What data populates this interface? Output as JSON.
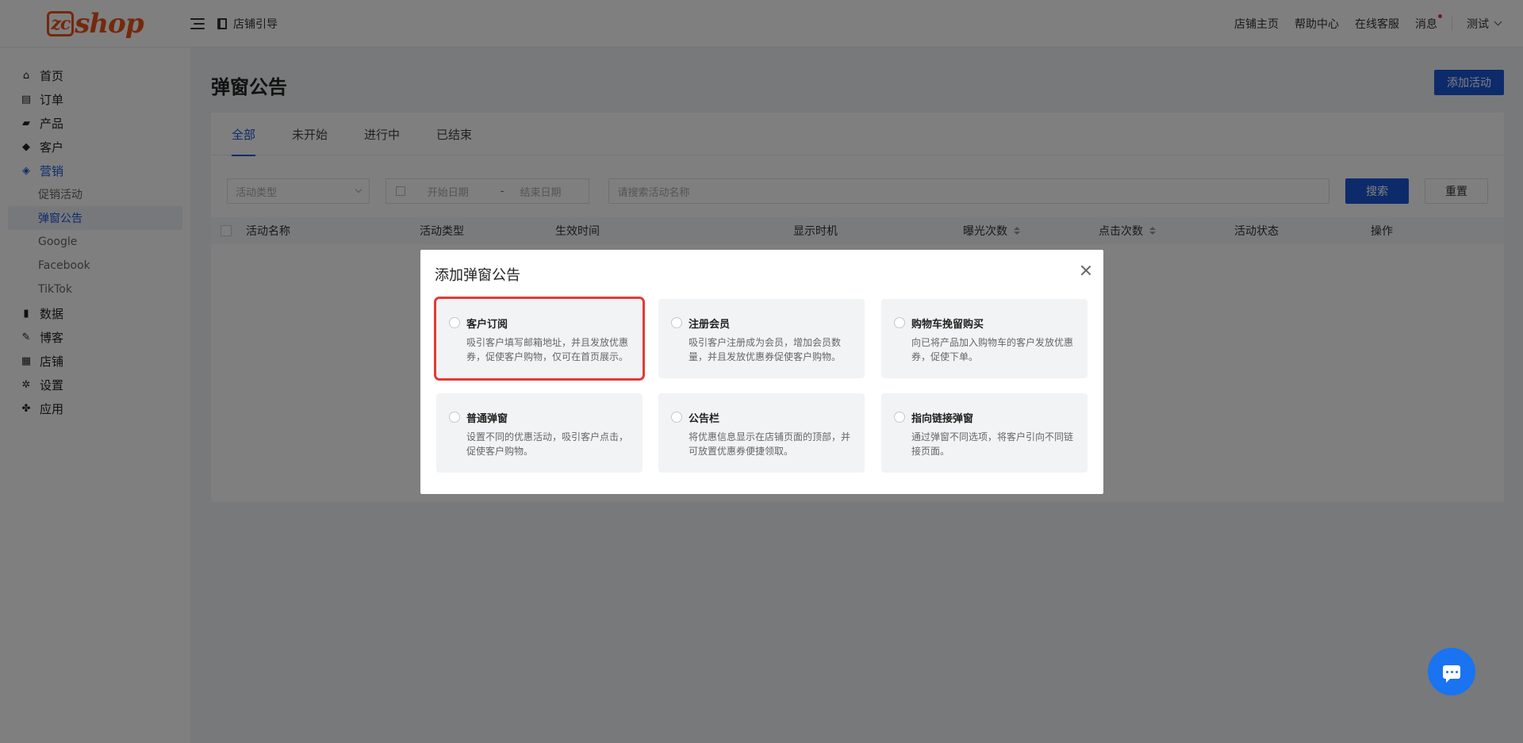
{
  "brand": {
    "logo_prefix": "zc",
    "logo_text": "shop",
    "logo_color": "#e8521a"
  },
  "header": {
    "store_guide": "店铺引导",
    "links": [
      "店铺主页",
      "帮助中心",
      "在线客服",
      "消息"
    ],
    "user": "测试"
  },
  "sidebar": {
    "items": [
      {
        "label": "首页",
        "icon": "home-icon"
      },
      {
        "label": "订单",
        "icon": "clipboard-icon"
      },
      {
        "label": "产品",
        "icon": "bag-icon"
      },
      {
        "label": "客户",
        "icon": "diamond-icon"
      },
      {
        "label": "营销",
        "icon": "tag-icon",
        "active": true
      },
      {
        "label": "数据",
        "icon": "bar-chart-icon"
      },
      {
        "label": "博客",
        "icon": "edit-icon"
      },
      {
        "label": "店铺",
        "icon": "store-icon"
      },
      {
        "label": "设置",
        "icon": "gear-icon"
      },
      {
        "label": "应用",
        "icon": "puzzle-icon"
      }
    ],
    "sub_items": [
      "促销活动",
      "弹窗公告",
      "Google",
      "Facebook",
      "TikTok"
    ],
    "selected_sub": "弹窗公告"
  },
  "page": {
    "title": "弹窗公告",
    "add_button": "添加活动",
    "tabs": [
      "全部",
      "未开始",
      "进行中",
      "已结束"
    ],
    "active_tab": "全部",
    "filters": {
      "type_placeholder": "活动类型",
      "start_placeholder": "开始日期",
      "date_sep": "-",
      "end_placeholder": "结束日期",
      "search_placeholder": "请搜索活动名称",
      "search_button": "搜索",
      "reset_button": "重置"
    },
    "columns": [
      "活动名称",
      "活动类型",
      "生效时间",
      "显示时机",
      "曝光次数",
      "点击次数",
      "活动状态",
      "操作"
    ]
  },
  "modal": {
    "title": "添加弹窗公告",
    "options": [
      {
        "title": "客户订阅",
        "desc": "吸引客户填写邮箱地址，并且发放优惠券，促使客户购物，仅可在首页展示。",
        "highlighted": true
      },
      {
        "title": "注册会员",
        "desc": "吸引客户注册成为会员，增加会员数量，并且发放优惠券促使客户购物。"
      },
      {
        "title": "购物车挽留购买",
        "desc": "向已将产品加入购物车的客户发放优惠券，促使下单。"
      },
      {
        "title": "普通弹窗",
        "desc": "设置不同的优惠活动，吸引客户点击，促使客户购物。"
      },
      {
        "title": "公告栏",
        "desc": "将优惠信息显示在店铺页面的顶部，并可放置优惠券便捷领取。"
      },
      {
        "title": "指向链接弹窗",
        "desc": "通过弹窗不同选项，将客户引向不同链接页面。"
      }
    ]
  },
  "colors": {
    "accent": "#1a56d6",
    "highlight_border": "#e53935",
    "chat_fab": "#1a73f0"
  }
}
